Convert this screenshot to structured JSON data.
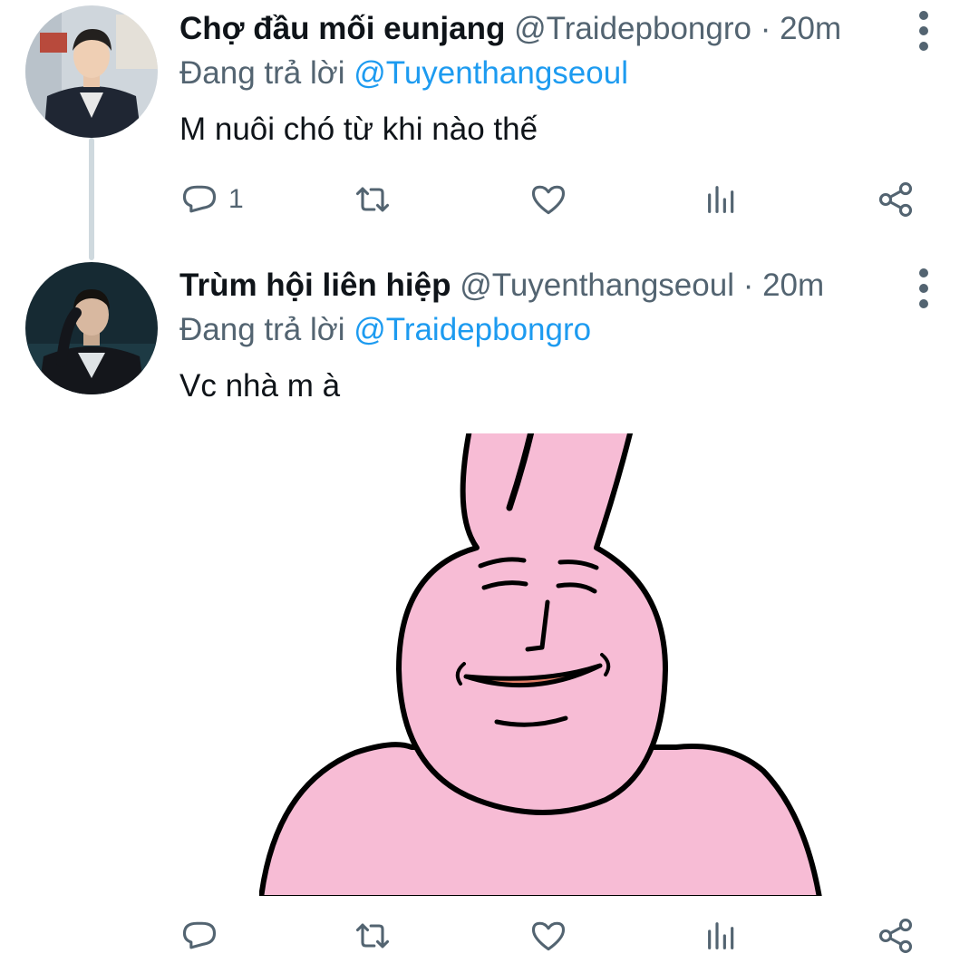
{
  "tweets": [
    {
      "display_name": "Chợ đầu mối eunjang",
      "handle": "@Traidepbongro",
      "dot": "·",
      "time": "20m",
      "reply_prefix": "Đang trả lời",
      "reply_to": "@Tuyenthangseoul",
      "text": "M nuôi chó từ khi nào thế",
      "reply_count": "1"
    },
    {
      "display_name": "Trùm hội liên hiệp",
      "handle": "@Tuyenthangseoul",
      "dot": "·",
      "time": "20m",
      "reply_prefix": "Đang trả lời",
      "reply_to": "@Traidepbongro",
      "text": "Vc nhà m à",
      "reply_count": ""
    }
  ],
  "icons": {
    "reply": "reply-icon",
    "retweet": "retweet-icon",
    "like": "heart-icon",
    "views": "analytics-icon",
    "share": "share-icon",
    "more": "more-vertical-icon"
  },
  "colors": {
    "text": "#0f1419",
    "muted": "#536471",
    "mention": "#1d9bf0",
    "thread_line": "#cfd9de",
    "sticker_pink": "#f7bcd5"
  }
}
